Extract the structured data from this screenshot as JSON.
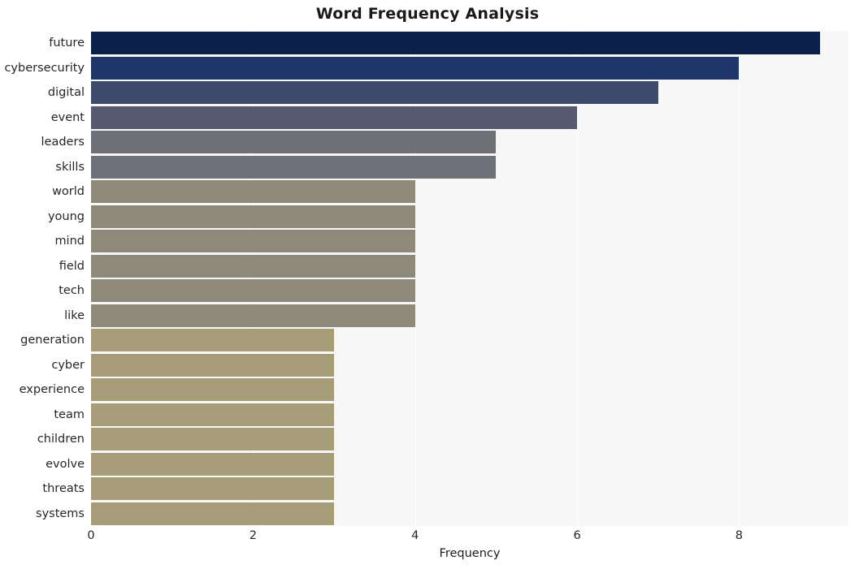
{
  "chart_data": {
    "type": "bar",
    "orientation": "horizontal",
    "title": "Word Frequency Analysis",
    "xlabel": "Frequency",
    "ylabel": "",
    "xlim": [
      0,
      9.35
    ],
    "xticks": [
      0,
      2,
      4,
      6,
      8
    ],
    "xticklabels": [
      "0",
      "2",
      "4",
      "6",
      "8"
    ],
    "grid": "vertical-white-on-gray",
    "legend": null,
    "background": "#f7f7f7",
    "categories": [
      "future",
      "cybersecurity",
      "digital",
      "event",
      "leaders",
      "skills",
      "world",
      "young",
      "mind",
      "field",
      "tech",
      "like",
      "generation",
      "cyber",
      "experience",
      "team",
      "children",
      "evolve",
      "threats",
      "systems"
    ],
    "values": [
      9,
      8,
      7,
      6,
      5,
      5,
      4,
      4,
      4,
      4,
      4,
      4,
      3,
      3,
      3,
      3,
      3,
      3,
      3,
      3
    ],
    "bar_colors": [
      "#0a2049",
      "#1f3668",
      "#3e4a6d",
      "#565a70",
      "#6f7077",
      "#70707a",
      "#8d8a7b",
      "#8d8a7b",
      "#8d8a7b",
      "#8d8a7b",
      "#8d8a7b",
      "#8d8a7b",
      "#a69d78",
      "#a69d78",
      "#a69d78",
      "#a69d78",
      "#a69d78",
      "#a69d78",
      "#a69d78",
      "#a69d78"
    ]
  }
}
